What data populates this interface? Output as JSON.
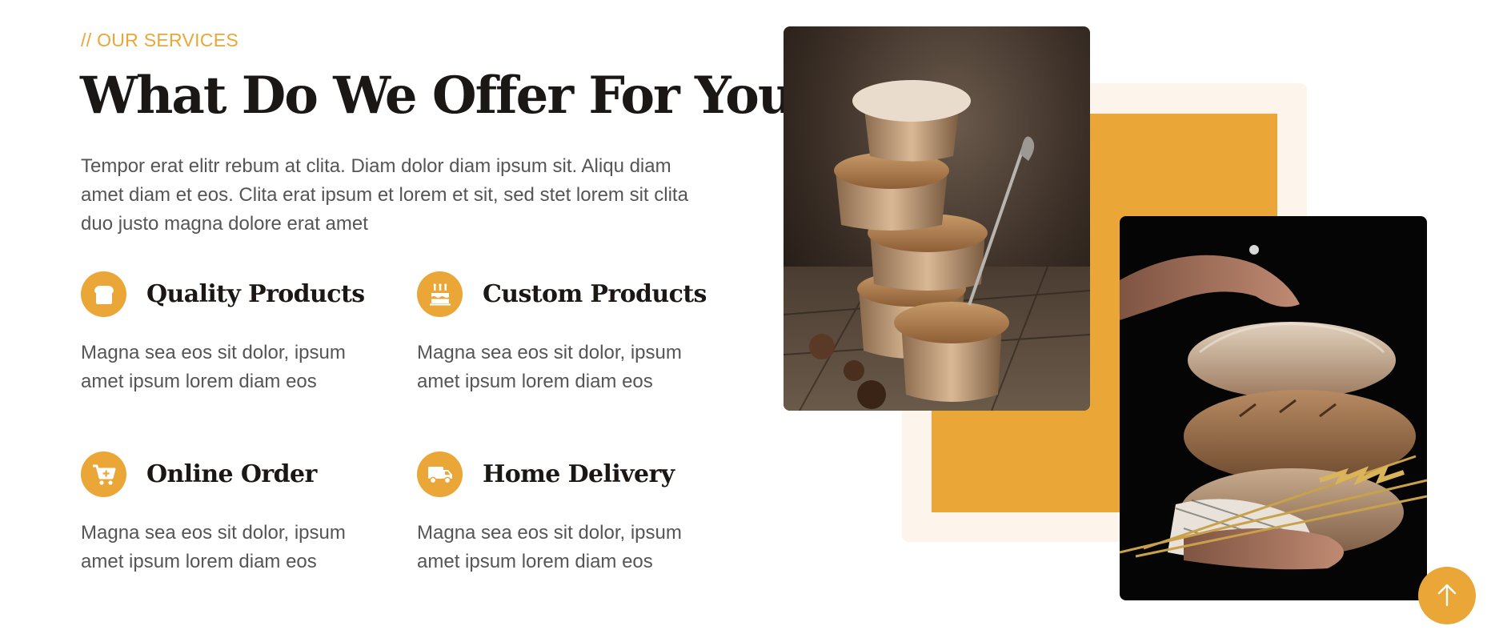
{
  "section": {
    "eyebrow": "// OUR SERVICES",
    "title": "What Do We Offer For You?",
    "intro": "Tempor erat elitr rebum at clita. Diam dolor diam ipsum sit. Aliqu diam amet diam et eos. Clita erat ipsum et lorem et sit, sed stet lorem sit clita duo justo magna dolore erat amet"
  },
  "services": [
    {
      "title": "Quality Products",
      "desc": "Magna sea eos sit dolor, ipsum amet ipsum lorem diam eos",
      "icon": "bread-icon"
    },
    {
      "title": "Custom Products",
      "desc": "Magna sea eos sit dolor, ipsum amet ipsum lorem diam eos",
      "icon": "cake-icon"
    },
    {
      "title": "Online Order",
      "desc": "Magna sea eos sit dolor, ipsum amet ipsum lorem diam eos",
      "icon": "cart-plus-icon"
    },
    {
      "title": "Home Delivery",
      "desc": "Magna sea eos sit dolor, ipsum amet ipsum lorem diam eos",
      "icon": "truck-icon"
    }
  ],
  "images": [
    {
      "name": "muffins-photo",
      "subject": "stack of muffins with powdered sugar and fork"
    },
    {
      "name": "bread-photo",
      "subject": "hands holding stack of bread loaves with wheat"
    }
  ],
  "back_to_top": {
    "icon": "arrow-up-icon"
  },
  "colors": {
    "accent": "#EAA636",
    "accent_light": "#FDF4EB",
    "heading": "#1b1715",
    "body": "#555555"
  }
}
